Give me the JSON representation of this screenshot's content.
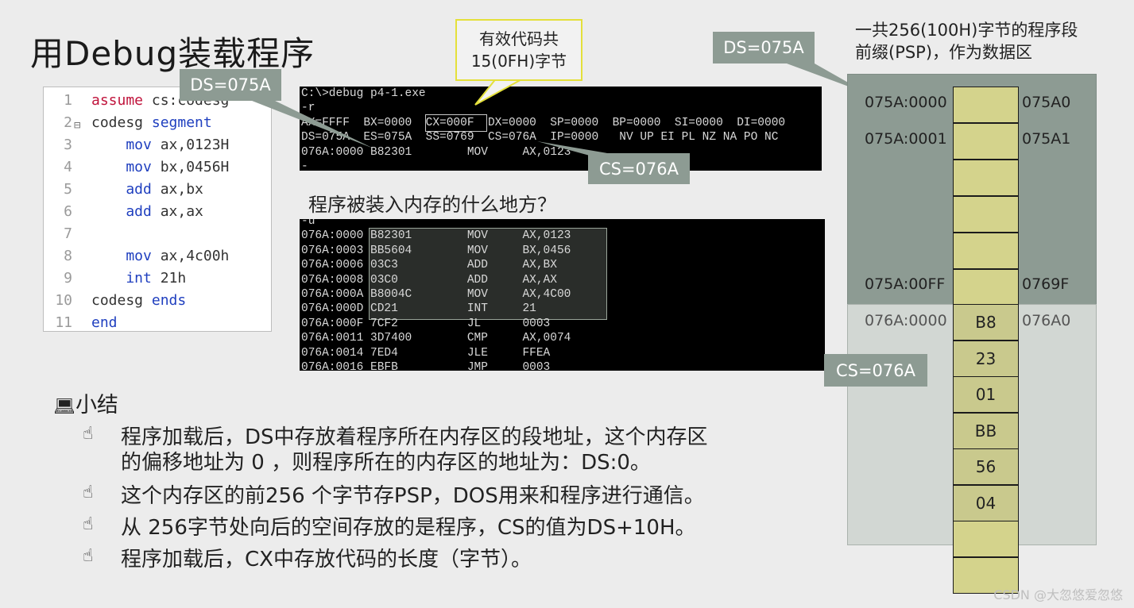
{
  "title": "用Debug装载程序",
  "code": {
    "lines": [
      {
        "n": "1",
        "fold": "",
        "parts": [
          {
            "t": "assume ",
            "c": "red"
          },
          {
            "t": "cs:codesg",
            "c": "reg"
          }
        ]
      },
      {
        "n": "2",
        "fold": "⊟",
        "parts": [
          {
            "t": "codesg ",
            "c": "reg"
          },
          {
            "t": "segment",
            "c": "blue"
          }
        ]
      },
      {
        "n": "3",
        "fold": "",
        "parts": [
          {
            "t": "    mov ",
            "c": "blue"
          },
          {
            "t": "ax,0123H",
            "c": "reg"
          }
        ]
      },
      {
        "n": "4",
        "fold": "",
        "parts": [
          {
            "t": "    mov ",
            "c": "blue"
          },
          {
            "t": "bx,0456H",
            "c": "reg"
          }
        ]
      },
      {
        "n": "5",
        "fold": "",
        "parts": [
          {
            "t": "    add ",
            "c": "blue"
          },
          {
            "t": "ax,bx",
            "c": "reg"
          }
        ]
      },
      {
        "n": "6",
        "fold": "",
        "parts": [
          {
            "t": "    add ",
            "c": "blue"
          },
          {
            "t": "ax,ax",
            "c": "reg"
          }
        ]
      },
      {
        "n": "7",
        "fold": "",
        "parts": []
      },
      {
        "n": "8",
        "fold": "",
        "parts": [
          {
            "t": "    mov ",
            "c": "blue"
          },
          {
            "t": "ax,4c00h",
            "c": "reg"
          }
        ]
      },
      {
        "n": "9",
        "fold": "",
        "parts": [
          {
            "t": "    int ",
            "c": "blue"
          },
          {
            "t": "21h",
            "c": "reg"
          }
        ]
      },
      {
        "n": "10",
        "fold": "",
        "parts": [
          {
            "t": "codesg ",
            "c": "reg"
          },
          {
            "t": "ends",
            "c": "blue"
          }
        ]
      },
      {
        "n": "11",
        "fold": "",
        "parts": [
          {
            "t": "end",
            "c": "blue"
          }
        ]
      }
    ]
  },
  "term1": {
    "lines": [
      "C:\\>debug p4-1.exe",
      "-r",
      "AX=FFFF  BX=0000  CX=000F  DX=0000  SP=0000  BP=0000  SI=0000  DI=0000",
      "DS=075A  ES=075A  SS=0769  CS=076A  IP=0000   NV UP EI PL NZ NA PO NC",
      "076A:0000 B82301        MOV     AX,0123",
      "-"
    ]
  },
  "term2": {
    "lines": [
      "-u",
      "076A:0000 B82301        MOV     AX,0123",
      "076A:0003 BB5604        MOV     BX,0456",
      "076A:0006 03C3          ADD     AX,BX",
      "076A:0008 03C0          ADD     AX,AX",
      "076A:000A B8004C        MOV     AX,4C00",
      "076A:000D CD21          INT     21",
      "076A:000F 7CF2          JL      0003",
      "076A:0011 3D7400        CMP     AX,0074",
      "076A:0014 7ED4          JLE     FFEA",
      "076A:0016 EBFB          JMP     0003"
    ]
  },
  "callouts": {
    "ds_left": "DS=075A",
    "ds_right": "DS=075A",
    "cs_term": "CS=076A",
    "cs_mem": "CS=076A",
    "valid_line1": "有效代码共",
    "valid_line2": "15(0FH)字节"
  },
  "question": "程序被装入内存的什么地方？",
  "summary": {
    "heading": "小结",
    "heading_icon": "computer-icon",
    "bullet_icon": "hand-pointer-icon",
    "items": [
      {
        "line1": "程序加载后，DS中存放着程序所在内存区的段地址，这个内存区",
        "line2": "的偏移地址为 0 ，则程序所在的内存区的地址为：DS:0。"
      },
      {
        "line1": "这个内存区的前256 个字节存PSP，DOS用来和程序进行通信。"
      },
      {
        "line1": "从 256字节处向后的空间存放的是程序，CS的值为DS+10H。"
      },
      {
        "line1": "程序加载后，CX中存放代码的长度（字节）。"
      }
    ]
  },
  "memory": {
    "caption_line1": "一共256(100H)字节的程序段",
    "caption_line2": "前缀(PSP)，作为数据区",
    "psp_left_labels": [
      "075A:0000",
      "075A:0001",
      "075A:00FF"
    ],
    "psp_right_labels": [
      "075A0",
      "075A1",
      "0769F"
    ],
    "prog_left_label": "076A:0000",
    "prog_right_label": "076A0",
    "psp_cells": [
      "",
      "",
      "",
      "",
      "",
      ""
    ],
    "prog_cells": [
      "B8",
      "23",
      "01",
      "BB",
      "56",
      "04",
      "",
      ""
    ]
  },
  "watermark": "CSDN @大忽悠爱忽悠"
}
